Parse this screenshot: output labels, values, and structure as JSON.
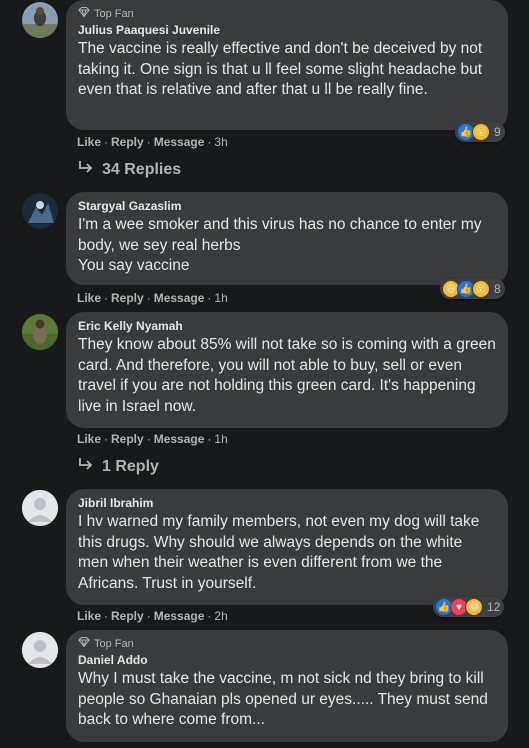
{
  "comments": [
    {
      "badge": "Top Fan",
      "name": "Julius Paaquesi Juvenile",
      "text": "The vaccine is really effective and don't be deceived by not taking it. One sign is that u ll feel some slight headache but even that is relative and after that u ll be really fine.",
      "actions": {
        "like": "Like",
        "reply": "Reply",
        "message": "Message",
        "time": "3h"
      },
      "reaction_count": "9",
      "replies": "34 Replies"
    },
    {
      "name": "Stargyal Gazaslim",
      "text": "I'm a wee smoker and this virus has no chance to enter my body, we sey real herbs\nYou say vaccine",
      "actions": {
        "like": "Like",
        "reply": "Reply",
        "message": "Message",
        "time": "1h"
      },
      "reaction_count": "8"
    },
    {
      "name": "Eric Kelly Nyamah",
      "text": "They know about 85% will not take so is coming with a green card. And therefore, you will not able to buy, sell or even travel if you are not holding this green card. It's happening live in Israel now.",
      "actions": {
        "like": "Like",
        "reply": "Reply",
        "message": "Message",
        "time": "1h"
      },
      "replies": "1 Reply"
    },
    {
      "name": "Jibril Ibrahim",
      "text": "I hv warned my family members, not even my dog will take this drugs. Why should we always depends on the white men when their weather is even different from we the Africans. Trust in yourself.",
      "actions": {
        "like": "Like",
        "reply": "Reply",
        "message": "Message",
        "time": "2h"
      },
      "reaction_count": "12"
    },
    {
      "badge": "Top Fan",
      "name": "Daniel Addo",
      "text": "Why I must take the vaccine, m not sick nd they bring to kill people so Ghanaian pls opened ur eyes..... They must send back to where come from..."
    }
  ],
  "sep": "·"
}
